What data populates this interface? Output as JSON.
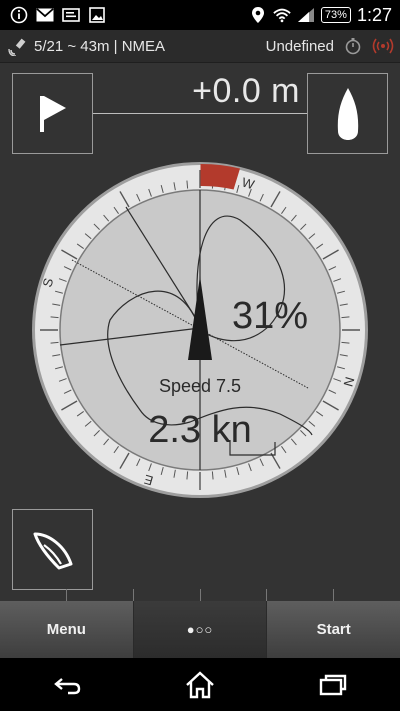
{
  "status_bar": {
    "battery": "73%",
    "time": "1:27",
    "icons": [
      "info-icon",
      "gmail-icon",
      "message-icon",
      "image-icon",
      "location-icon",
      "wifi-icon",
      "signal-icon",
      "battery-icon"
    ]
  },
  "info_bar": {
    "gps_status": "5/21 ~ 43m | NMEA",
    "mode": "Undefined",
    "icons": [
      "gps-satellite-icon",
      "stopwatch-icon",
      "radio-signal-icon"
    ]
  },
  "distance": "+0.0 m",
  "compass": {
    "cardinals": [
      "N",
      "E",
      "S",
      "W"
    ],
    "percent": "31%",
    "speed_label": "Speed 7.5",
    "speed_value": "2.3 kn",
    "colors": {
      "ring": "#e3e3e3",
      "face": "#c8c8c8",
      "marker": "#b33a2c",
      "needle": "#1a1a1a"
    }
  },
  "buttons": {
    "menu": "Menu",
    "more": "●○○",
    "start": "Start"
  }
}
